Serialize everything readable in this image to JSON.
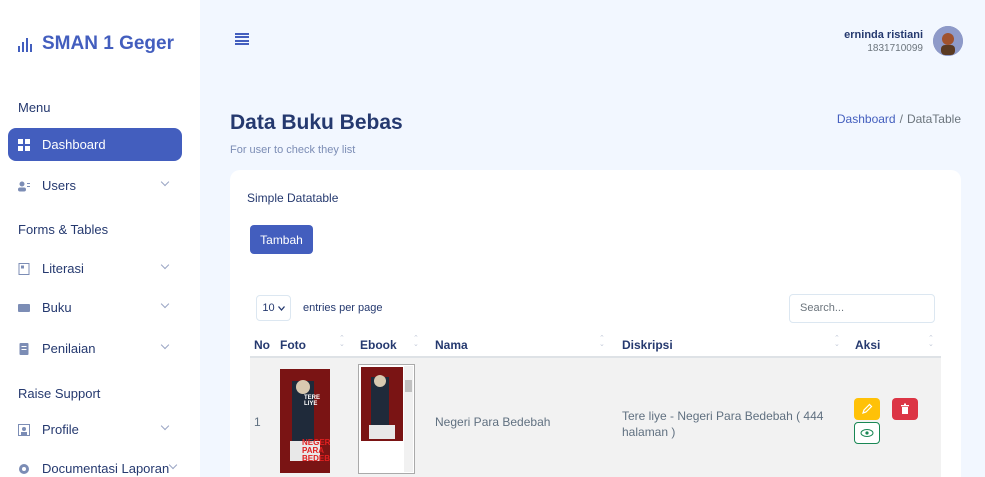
{
  "brand": {
    "name": "SMAN 1 Geger"
  },
  "sidebar": {
    "sections": [
      "Menu",
      "Forms & Tables",
      "Raise Support"
    ],
    "items": [
      {
        "label": "Dashboard",
        "icon": "grid-icon",
        "active": true
      },
      {
        "label": "Users",
        "icon": "users-icon"
      },
      {
        "label": "Literasi",
        "icon": "file-icon"
      },
      {
        "label": "Buku",
        "icon": "book-icon"
      },
      {
        "label": "Penilaian",
        "icon": "clipboard-icon"
      },
      {
        "label": "Profile",
        "icon": "profile-icon"
      },
      {
        "label": "Documentasi Laporan",
        "icon": "gear-icon"
      }
    ]
  },
  "user": {
    "name": "erninda ristiani",
    "id": "1831710099"
  },
  "page": {
    "title": "Data Buku Bebas",
    "subtitle": "For user to check they list",
    "breadcrumb": {
      "home": "Dashboard",
      "sep": "/",
      "current": "DataTable"
    }
  },
  "card": {
    "title": "Simple Datatable",
    "add_button": "Tambah",
    "entries_value": "10",
    "entries_label": "entries per page",
    "search_placeholder": "Search..."
  },
  "table": {
    "columns": [
      "No",
      "Foto",
      "Ebook",
      "Nama",
      "Diskripsi",
      "Aksi"
    ],
    "rows": [
      {
        "no": "1",
        "cover_text_1": "TERE LIYE",
        "cover_text_2": "NEGERI PARA BEDEBAH",
        "nama": "Negeri Para Bedebah",
        "diskripsi": "Tere liye - Negeri Para Bedebah ( 444 halaman )"
      }
    ]
  },
  "colors": {
    "primary": "#435ebe",
    "warning": "#ffc107",
    "danger": "#dc3545",
    "success": "#198754"
  }
}
